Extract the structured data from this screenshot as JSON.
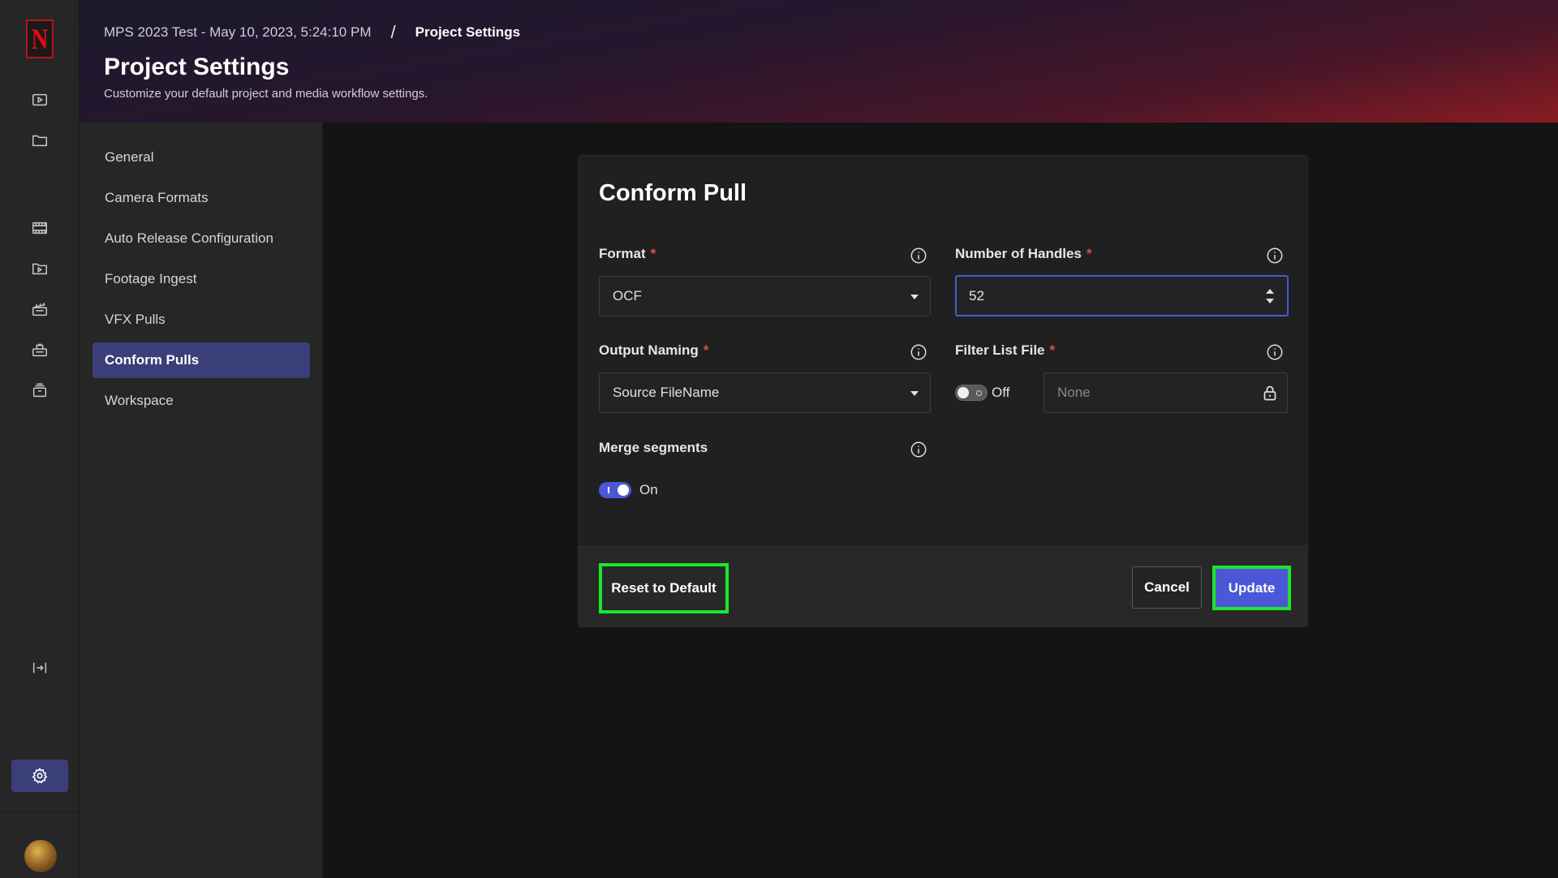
{
  "app": {
    "logo_letter": "N",
    "rail_icons": [
      "play-box-icon",
      "folder-icon",
      "film-strip-icon",
      "play-folder-icon",
      "clapper-board-icon",
      "camera-clapper-icon",
      "archive-box-icon",
      "collapse-expand-icon",
      "gear-icon"
    ]
  },
  "header": {
    "breadcrumb": {
      "project": "MPS 2023 Test - May 10, 2023, 5:24:10 PM",
      "separator": "/",
      "current": "Project Settings"
    },
    "title": "Project Settings",
    "subtitle": "Customize your default project and media workflow settings."
  },
  "nav": {
    "items": [
      {
        "label": "General"
      },
      {
        "label": "Camera Formats"
      },
      {
        "label": "Auto Release Configuration"
      },
      {
        "label": "Footage Ingest"
      },
      {
        "label": "VFX Pulls"
      },
      {
        "label": "Conform Pulls",
        "active": true
      },
      {
        "label": "Workspace"
      }
    ]
  },
  "form": {
    "title": "Conform Pull",
    "format": {
      "label": "Format",
      "required_mark": "*",
      "value": "OCF"
    },
    "handles": {
      "label": "Number of Handles",
      "required_mark": "*",
      "value": "52"
    },
    "output_naming": {
      "label": "Output Naming",
      "required_mark": "*",
      "value": "Source FileName"
    },
    "filter_list": {
      "label": "Filter List File",
      "required_mark": "*",
      "toggle_state": "Off",
      "placeholder": "None"
    },
    "merge_segments": {
      "label": "Merge segments",
      "toggle_state": "On"
    }
  },
  "footer": {
    "reset_label": "Reset to Default",
    "cancel_label": "Cancel",
    "update_label": "Update"
  },
  "colors": {
    "accent": "#4b57d6",
    "highlight_outline": "#1ee62a",
    "required": "#e24b4b",
    "brand": "#e50914"
  }
}
